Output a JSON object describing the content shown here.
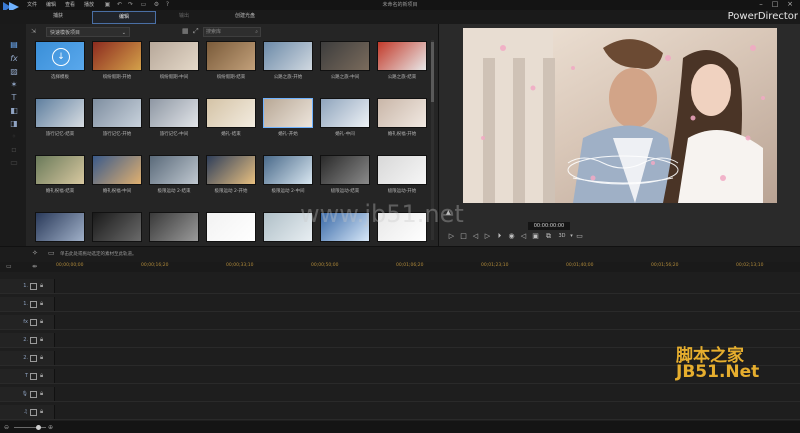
{
  "titlebar": {
    "menu": [
      "文件",
      "编辑",
      "查看",
      "播放"
    ],
    "project_title": "未命名的新项目"
  },
  "tabs": {
    "capture": "捕获",
    "edit": "编辑",
    "produce": "输出",
    "create_disc": "创建光盘"
  },
  "brand": "PowerDirector",
  "library": {
    "filter": "快速模板项目",
    "search_placeholder": "搜索库",
    "items": [
      {
        "label": "选择模板",
        "kind": "download"
      },
      {
        "label": "缤纷假期-开始"
      },
      {
        "label": "缤纷假期-中间"
      },
      {
        "label": "缤纷假期-结束"
      },
      {
        "label": "公路之旅-开始"
      },
      {
        "label": "公路之旅-中间"
      },
      {
        "label": "公路之旅-结束"
      },
      {
        "label": "旅行记忆-结束"
      },
      {
        "label": "旅行记忆-开始"
      },
      {
        "label": "旅行记忆-中间"
      },
      {
        "label": "婚礼-结束"
      },
      {
        "label": "婚礼-开始"
      },
      {
        "label": "婚礼-中间"
      },
      {
        "label": "婚礼祝福-开始"
      },
      {
        "label": "婚礼祝福-结束"
      },
      {
        "label": "婚礼祝福-中间"
      },
      {
        "label": "极限运动 2-结束"
      },
      {
        "label": "极限运动 2-开始"
      },
      {
        "label": "极限运动 2-中间"
      },
      {
        "label": "极限运动-结束"
      },
      {
        "label": "极限运动-开始"
      },
      {
        "label": ""
      },
      {
        "label": ""
      },
      {
        "label": ""
      },
      {
        "label": ""
      },
      {
        "label": ""
      },
      {
        "label": ""
      },
      {
        "label": ""
      }
    ]
  },
  "preview": {
    "timecode": "00:00:00:00",
    "mode_3d": "3D"
  },
  "timeline": {
    "hint": "单击此处或拖动选定的素材至此轨道。",
    "ruler": [
      "00;00;00;00",
      "00;00;16;20",
      "00;00;33;10",
      "00;00;50;00",
      "00;01;06;20",
      "00;01;23;10",
      "00;01;40;00",
      "00;01;56;20",
      "00;02;13;10"
    ],
    "tracks": [
      {
        "icon": "video-track-icon",
        "label": "1."
      },
      {
        "icon": "audio-track-icon",
        "label": "1."
      },
      {
        "icon": "fx-track-icon",
        "label": "fx"
      },
      {
        "icon": "video-track-icon",
        "label": "2."
      },
      {
        "icon": "audio-track-icon",
        "label": "2."
      },
      {
        "icon": "title-track-icon",
        "label": "T"
      },
      {
        "icon": "voice-track-icon",
        "label": "🎙"
      },
      {
        "icon": "music-track-icon",
        "label": "♫"
      }
    ]
  },
  "watermarks": {
    "url": "www.jb51.net",
    "cn": "脚本之家",
    "net": "JB51.Net"
  }
}
